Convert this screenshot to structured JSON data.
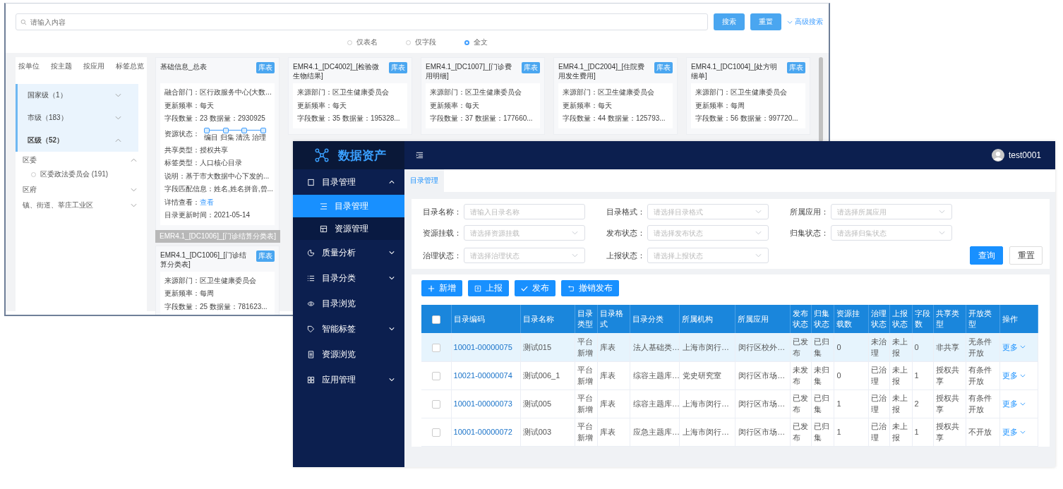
{
  "back_window": {
    "search": {
      "placeholder": "请输入内容"
    },
    "buttons": [
      "搜索",
      "重置"
    ],
    "advanced_link": "高级搜索",
    "scope_options": [
      {
        "label": "仅表名",
        "selected": false
      },
      {
        "label": "仅字段",
        "selected": false
      },
      {
        "label": "全文",
        "selected": true
      }
    ],
    "tabs": [
      {
        "label": "按单位",
        "selected": false
      },
      {
        "label": "按主题",
        "selected": false
      },
      {
        "label": "按应用",
        "selected": false
      },
      {
        "label": "标签总览",
        "selected": false
      }
    ],
    "groups": [
      {
        "label": "国家级（1）",
        "expanded": false
      },
      {
        "label": "市级（183）",
        "expanded": false
      },
      {
        "label": "区级（52）",
        "expanded": true
      }
    ],
    "subgroups": [
      {
        "label": "区委",
        "expanded": true,
        "items": [
          {
            "label": "区委政法委员会 (191)",
            "selected": false
          }
        ]
      },
      {
        "label": "区府",
        "expanded": false
      },
      {
        "label": "镇、街道、莘庄工业区",
        "expanded": false
      }
    ],
    "card_columns": [
      [
        {
          "title": "基础信息_总表",
          "badge": "库表",
          "fields": [
            {
              "kind": "text",
              "text": "融合部门：区行政服务中心(大数..."
            },
            {
              "kind": "text",
              "text": "更新频率：每天"
            },
            {
              "kind": "text",
              "text": "字段数量：23   数据量：2930925"
            },
            {
              "kind": "steps",
              "label": "资源状态：",
              "steps": [
                "编目",
                "归集",
                "清洗",
                "治理"
              ]
            },
            {
              "kind": "text",
              "text": "共享类型：授权共享"
            },
            {
              "kind": "text",
              "text": "标签类型：人口核心目录"
            },
            {
              "kind": "text",
              "text": "说明：基于市大数据中心下发的..."
            },
            {
              "kind": "text",
              "text": "字段匹配信息：姓名,姓名拼音,曾..."
            },
            {
              "kind": "link",
              "label": "详情查看：",
              "link": "查看"
            },
            {
              "kind": "text",
              "text": "目录更新时间：2021-05-14"
            }
          ]
        },
        {
          "tooltip": "EMR4.1_[DC1006]_[门诊结算分类表]",
          "title": "EMR4.1_[DC1006]_[门诊结算分类表]",
          "badge": "库表",
          "fields": [
            {
              "kind": "text",
              "text": "来源部门：区卫生健康委员会"
            },
            {
              "kind": "text",
              "text": "更新频率：每周"
            },
            {
              "kind": "text",
              "text": "字段数量：25   数据量：781623..."
            }
          ]
        }
      ],
      [
        {
          "title": "EMR4.1_[DC4002]_[检验微生物结果]",
          "badge": "库表",
          "fields": [
            {
              "kind": "text",
              "text": "来源部门：区卫生健康委员会"
            },
            {
              "kind": "text",
              "text": "更新频率：每天"
            },
            {
              "kind": "text",
              "text": "字段数量：35   数据量：195328..."
            }
          ]
        }
      ],
      [
        {
          "title": "EMR4.1_[DC1007]_[门诊费用明细]",
          "badge": "库表",
          "fields": [
            {
              "kind": "text",
              "text": "来源部门：区卫生健康委员会"
            },
            {
              "kind": "text",
              "text": "更新频率：每天"
            },
            {
              "kind": "text",
              "text": "字段数量：37   数据量：177660..."
            }
          ]
        }
      ],
      [
        {
          "title": "EMR4.1_[DC2004]_[住院费用发生费用]",
          "badge": "库表",
          "fields": [
            {
              "kind": "text",
              "text": "来源部门：区卫生健康委员会"
            },
            {
              "kind": "text",
              "text": "更新频率：每天"
            },
            {
              "kind": "text",
              "text": "字段数量：44   数据量：125793..."
            }
          ]
        }
      ],
      [
        {
          "title": "EMR4.1_[DC1004]_[处方明细单]",
          "badge": "库表",
          "fields": [
            {
              "kind": "text",
              "text": "来源部门：区卫生健康委员会"
            },
            {
              "kind": "text",
              "text": "更新频率：每周"
            },
            {
              "kind": "text",
              "text": "字段数量：56   数据量：997720..."
            }
          ]
        }
      ]
    ]
  },
  "front_window": {
    "logo": "数据资产",
    "user": "test0001",
    "menu": [
      {
        "label": "目录管理",
        "expanded": true,
        "children": [
          {
            "label": "目录管理",
            "selected": true
          },
          {
            "label": "资源管理",
            "selected": false
          }
        ]
      },
      {
        "label": "质量分析",
        "expanded": false
      },
      {
        "label": "目录分类",
        "expanded": false
      },
      {
        "label": "目录浏览"
      },
      {
        "label": "智能标签",
        "expanded": false
      },
      {
        "label": "资源浏览"
      },
      {
        "label": "应用管理",
        "expanded": false
      }
    ],
    "page_tabs": [
      {
        "label": "目录管理",
        "selected": true
      }
    ],
    "filters": [
      {
        "kind": "input",
        "label": "目录名称：",
        "placeholder": "请输入目录名称"
      },
      {
        "kind": "select",
        "label": "目录格式：",
        "placeholder": "请选择目录格式"
      },
      {
        "kind": "select",
        "label": "所属应用：",
        "placeholder": "请选择所属应用"
      },
      {
        "kind": "select",
        "label": "资源挂载：",
        "placeholder": "请选择资源挂载"
      },
      {
        "kind": "select",
        "label": "发布状态：",
        "placeholder": "请选择发布状态"
      },
      {
        "kind": "select",
        "label": "归集状态：",
        "placeholder": "请选择归集状态"
      },
      {
        "kind": "select",
        "label": "治理状态：",
        "placeholder": "请选择治理状态"
      },
      {
        "kind": "select",
        "label": "上报状态：",
        "placeholder": "请选择上报状态"
      }
    ],
    "filter_buttons": [
      {
        "label": "查询",
        "kind": "primary"
      },
      {
        "label": "重置",
        "kind": "plain"
      }
    ],
    "actions": [
      {
        "label": "新增",
        "kind": "plus"
      },
      {
        "label": "上报",
        "kind": "upload"
      },
      {
        "label": "发布",
        "kind": "check"
      },
      {
        "label": "撤销发布",
        "kind": "undo"
      }
    ],
    "table": {
      "all_checked": false,
      "columns": [
        "目录编码",
        "目录名称",
        "目录类型",
        "目录格式",
        "目录分类",
        "所属机构",
        "所属应用",
        "发布状态",
        "归集状态",
        "资源挂载数",
        "治理状态",
        "上报状态",
        "字段数",
        "共享类型",
        "开放类型",
        "操作"
      ],
      "rows": [
        {
          "highlighted": true,
          "checked": false,
          "cells": [
            "10001-00000075",
            "测试015",
            "平台新增",
            "库表",
            "法人基础类…",
            "上海市闵行…",
            "闵行区校外…",
            "已发布",
            "已归集",
            "0",
            "未治理",
            "未上报",
            "0",
            "非共享",
            "无条件开放"
          ],
          "action": "更多"
        },
        {
          "highlighted": false,
          "checked": false,
          "cells": [
            "10021-00000074",
            "测试006_1",
            "平台新增",
            "库表",
            "综容主题库…",
            "党史研究室",
            "闵行区市场…",
            "未发布",
            "未归集",
            "0",
            "已治理",
            "未上报",
            "1",
            "授权共享",
            "有条件开放"
          ],
          "action": "更多"
        },
        {
          "highlighted": false,
          "checked": false,
          "cells": [
            "10001-00000073",
            "测试005",
            "平台新增",
            "库表",
            "综容主题库…",
            "上海市闵行…",
            "闵行区市场…",
            "已发布",
            "已归集",
            "1",
            "已治理",
            "未上报",
            "2",
            "授权共享",
            "有条件开放"
          ],
          "action": "更多"
        },
        {
          "highlighted": false,
          "checked": false,
          "cells": [
            "10001-00000072",
            "测试003",
            "平台新增",
            "库表",
            "应急主题库…",
            "上海市闵行…",
            "闵行区市场…",
            "已发布",
            "已归集",
            "1",
            "已治理",
            "未上报",
            "1",
            "授权共享",
            "不开放"
          ],
          "action": "更多"
        }
      ]
    }
  }
}
